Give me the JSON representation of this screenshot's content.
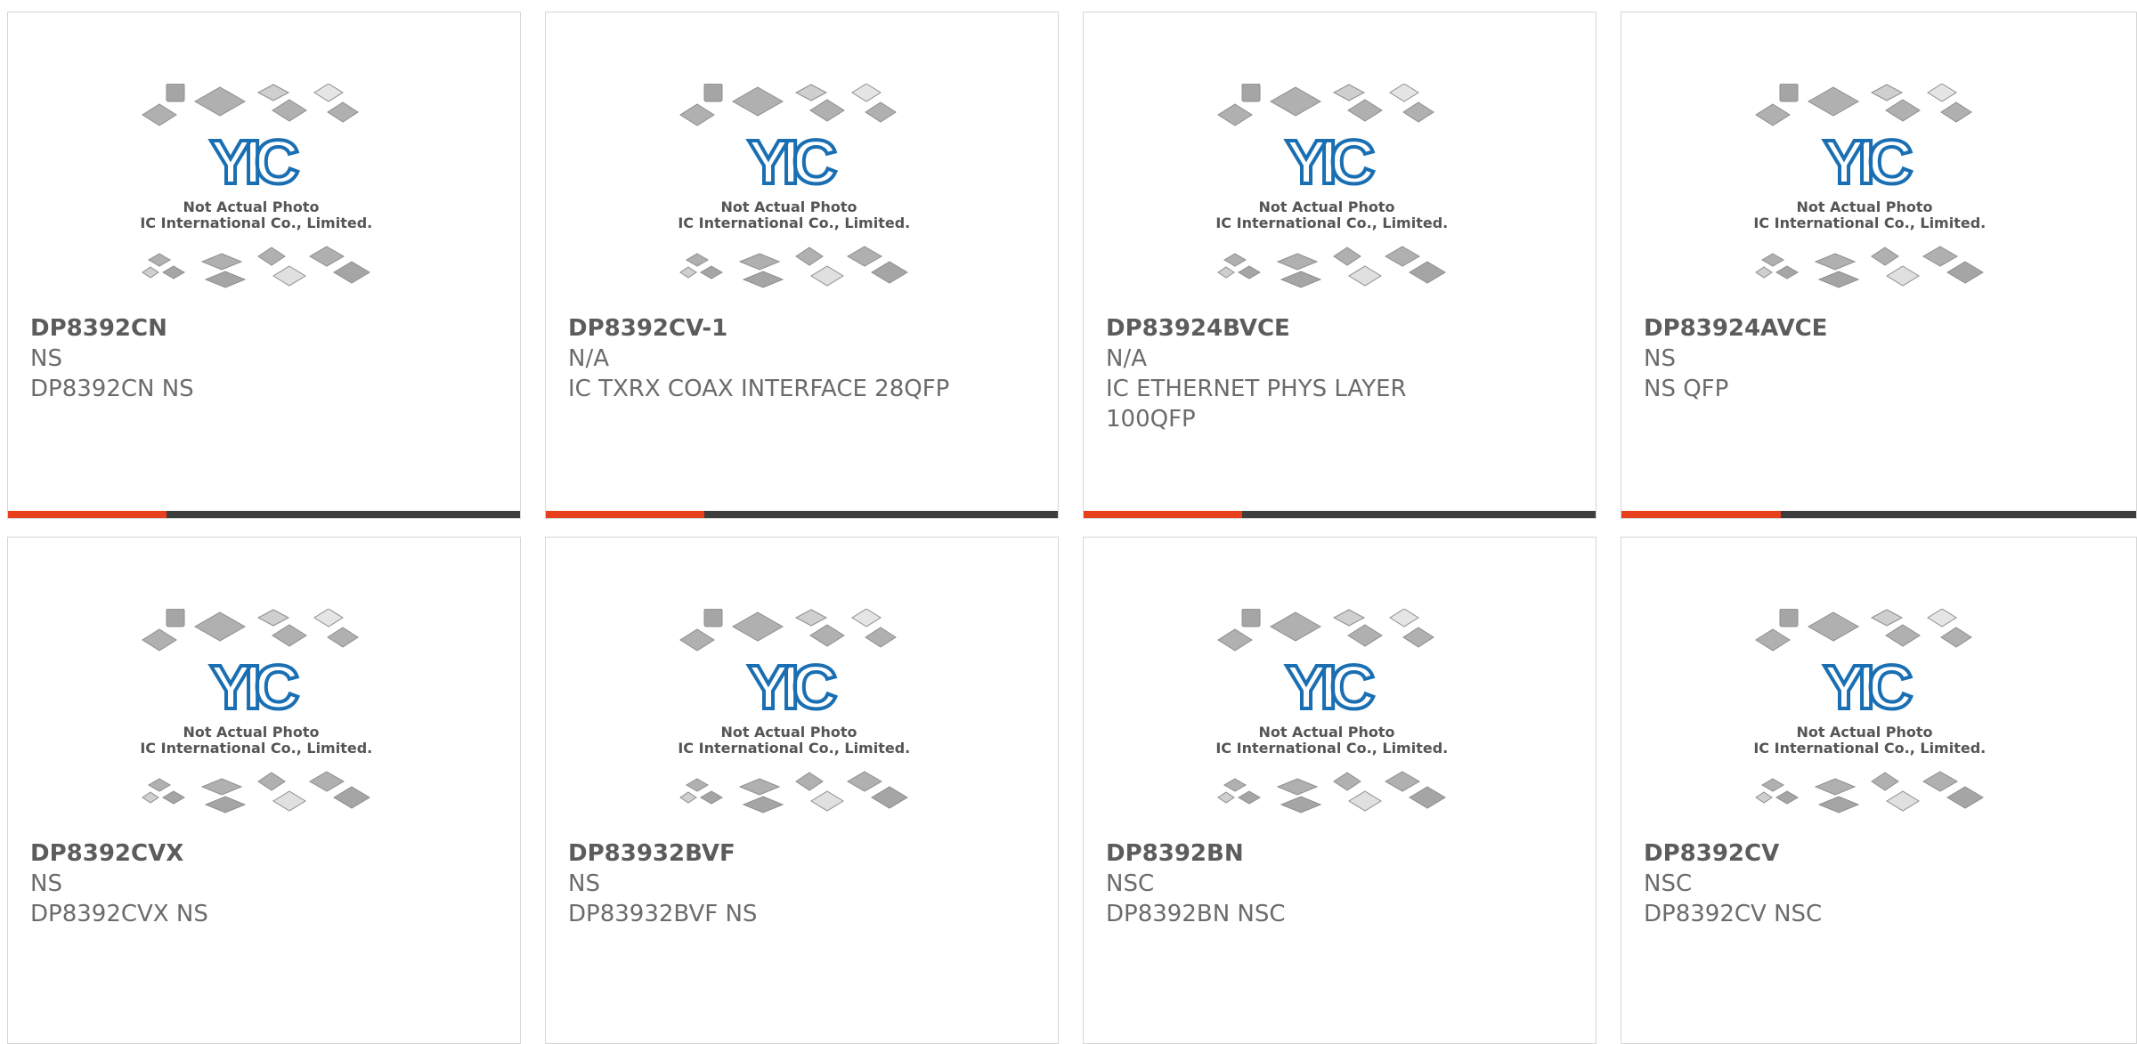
{
  "colors": {
    "bar_dark": "#3d3d3d",
    "bar_accent": "#e8401c",
    "logo_blue": "#1a6fb3",
    "text": "#6b6b6b"
  },
  "placeholder": {
    "line1": "Not Actual Photo",
    "line2": "YIC International Co., Limited.",
    "logo_text": "YIC"
  },
  "products": [
    {
      "part": "DP8392CN",
      "mfr": "NS",
      "desc": "DP8392CN NS",
      "progress_pct": 31
    },
    {
      "part": "DP8392CV-1",
      "mfr": "N/A",
      "desc": "IC TXRX COAX INTERFACE 28QFP",
      "progress_pct": 31
    },
    {
      "part": "DP83924BVCE",
      "mfr": "N/A",
      "desc": "IC ETHERNET PHYS LAYER 100QFP",
      "progress_pct": 31
    },
    {
      "part": "DP83924AVCE",
      "mfr": "NS",
      "desc": "NS QFP",
      "progress_pct": 31
    },
    {
      "part": "DP8392CVX",
      "mfr": "NS",
      "desc": "DP8392CVX NS"
    },
    {
      "part": "DP83932BVF",
      "mfr": "NS",
      "desc": "DP83932BVF NS"
    },
    {
      "part": "DP8392BN",
      "mfr": "NSC",
      "desc": "DP8392BN NSC"
    },
    {
      "part": "DP8392CV",
      "mfr": "NSC",
      "desc": "DP8392CV NSC"
    }
  ]
}
